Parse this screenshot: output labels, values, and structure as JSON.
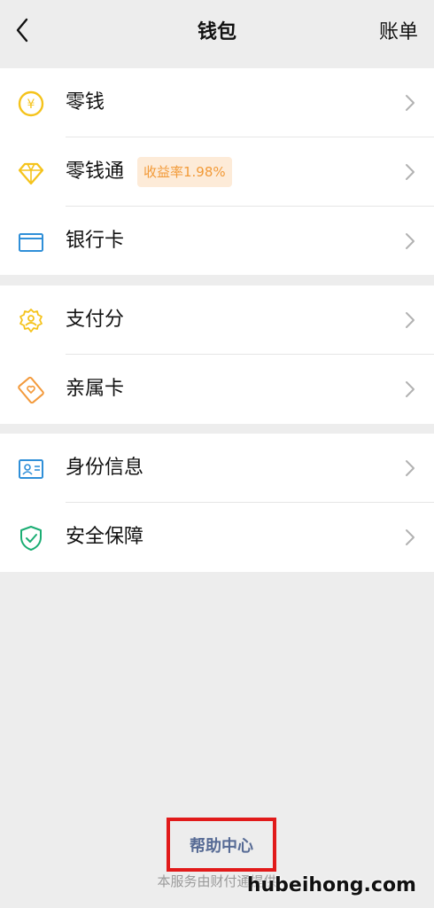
{
  "header": {
    "title": "钱包",
    "bill_label": "账单"
  },
  "groups": [
    {
      "items": [
        {
          "label": "零钱",
          "icon": "yuan-coin-icon"
        },
        {
          "label": "零钱通",
          "icon": "diamond-icon",
          "badge": "收益率1.98%"
        },
        {
          "label": "银行卡",
          "icon": "bank-card-icon"
        }
      ]
    },
    {
      "items": [
        {
          "label": "支付分",
          "icon": "payscore-badge-icon"
        },
        {
          "label": "亲属卡",
          "icon": "family-card-icon"
        }
      ]
    },
    {
      "items": [
        {
          "label": "身份信息",
          "icon": "id-card-icon"
        },
        {
          "label": "安全保障",
          "icon": "shield-check-icon"
        }
      ]
    }
  ],
  "footer": {
    "help_label": "帮助中心",
    "provider_note": "本服务由财付通提供",
    "watermark": "hubeihong.com"
  },
  "colors": {
    "background": "#ededed",
    "card": "#ffffff",
    "link_blue": "#576b95",
    "highlight_red": "#e11a1a",
    "badge_bg": "#fdebd8",
    "badge_text": "#f29a38",
    "yellow_icon": "#f5c31b",
    "blue_icon": "#2f8fd8",
    "orange_icon": "#f39a3c",
    "green_icon": "#1aad73"
  }
}
